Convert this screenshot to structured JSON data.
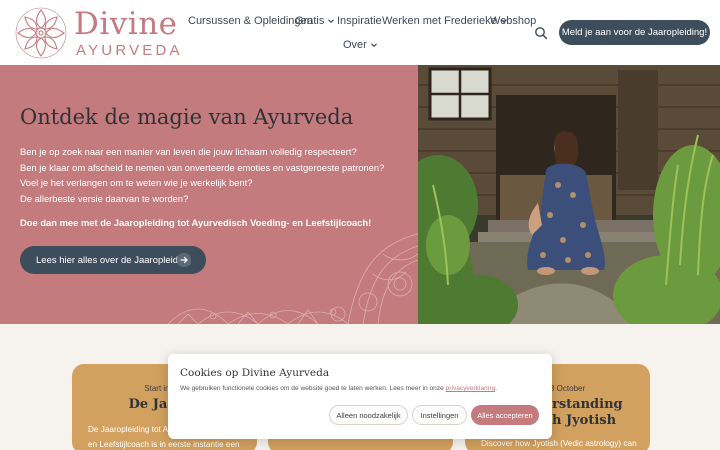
{
  "brand": {
    "name_main": "Divine",
    "name_sub": "AYURVEDA"
  },
  "nav": {
    "items": [
      {
        "label": "Cursussen & Opleidingen",
        "has_dropdown": false
      },
      {
        "label": "Gratis",
        "has_dropdown": true
      },
      {
        "label": "Inspiratie",
        "has_dropdown": false
      },
      {
        "label": "Werken met Frederieke",
        "has_dropdown": true
      },
      {
        "label": "Webshop",
        "has_dropdown": false
      },
      {
        "label": "Over",
        "has_dropdown": true
      }
    ],
    "search_icon": "search-icon",
    "cta_label": "Meld je aan voor de Jaaropleiding!"
  },
  "hero": {
    "title": "Ontdek de magie van Ayurveda",
    "lines": [
      "Ben je op zoek naar een manier van leven die jouw lichaam volledig respecteert?",
      "Ben je klaar om afscheid te nemen van onverteerde emoties en vastgeroeste patronen?",
      "Voel je het verlangen om te weten wie je werkelijk bent?",
      "De allerbeste versie daarvan te worden?"
    ],
    "strong_line": "Doe dan mee met de Jaaropleiding tot Ayurvedisch Voeding- en Leefstijlcoach!",
    "button_label": "Lees hier alles over de Jaaropleiding",
    "image_alt": "photo-woman-sitting-in-garden"
  },
  "cards": [
    {
      "date": "Start in sep",
      "title": "De Jaarop",
      "desc_lines": [
        "De Jaaropleiding tot A",
        "en Leefstijlcoach is in eerste instantie een"
      ]
    },
    {
      "date": "",
      "title": "",
      "desc_lines": []
    },
    {
      "date": "3 October",
      "title": "rstanding",
      "title2": "h Jyotish",
      "desc_lines": [
        "Discover how Jyotish (Vedic astrology) can"
      ]
    }
  ],
  "cookie": {
    "title": "Cookies op Divine Ayurveda",
    "text": "We gebruiken functionele cookies om de website goed te laten werken. Lees meer in onze",
    "link": "privacyverklaring",
    "text_end": ".",
    "btn_necessary": "Alleen noodzakelijk",
    "btn_settings": "Instellingen",
    "btn_accept": "Alles accepteren"
  },
  "colors": {
    "accent_rose": "#c37b7e",
    "logo_rose": "#c57a80",
    "navy": "#3e4d5c",
    "card_gold": "#d2a15f",
    "page_bg": "#f6f3ef"
  }
}
